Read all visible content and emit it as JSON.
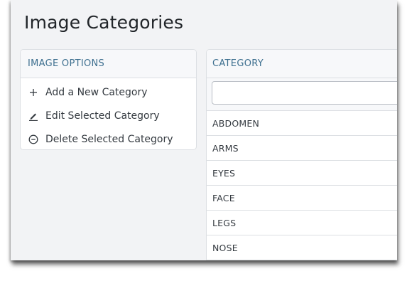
{
  "page": {
    "title": "Image Categories"
  },
  "options_panel": {
    "header": "IMAGE OPTIONS",
    "items": [
      {
        "label": "Add a New Category",
        "icon": "plus-icon"
      },
      {
        "label": "Edit Selected Category",
        "icon": "pencil-icon"
      },
      {
        "label": "Delete Selected Category",
        "icon": "minus-circle-icon"
      }
    ]
  },
  "category_panel": {
    "header": "CATEGORY",
    "filter_value": "",
    "rows": [
      "ABDOMEN",
      "ARMS",
      "EYES",
      "FACE",
      "LEGS",
      "NOSE"
    ]
  },
  "colors": {
    "header_text": "#3d6f8f",
    "body_text": "#343a40",
    "border": "#dcdfe3",
    "background": "#f2f3f5"
  }
}
